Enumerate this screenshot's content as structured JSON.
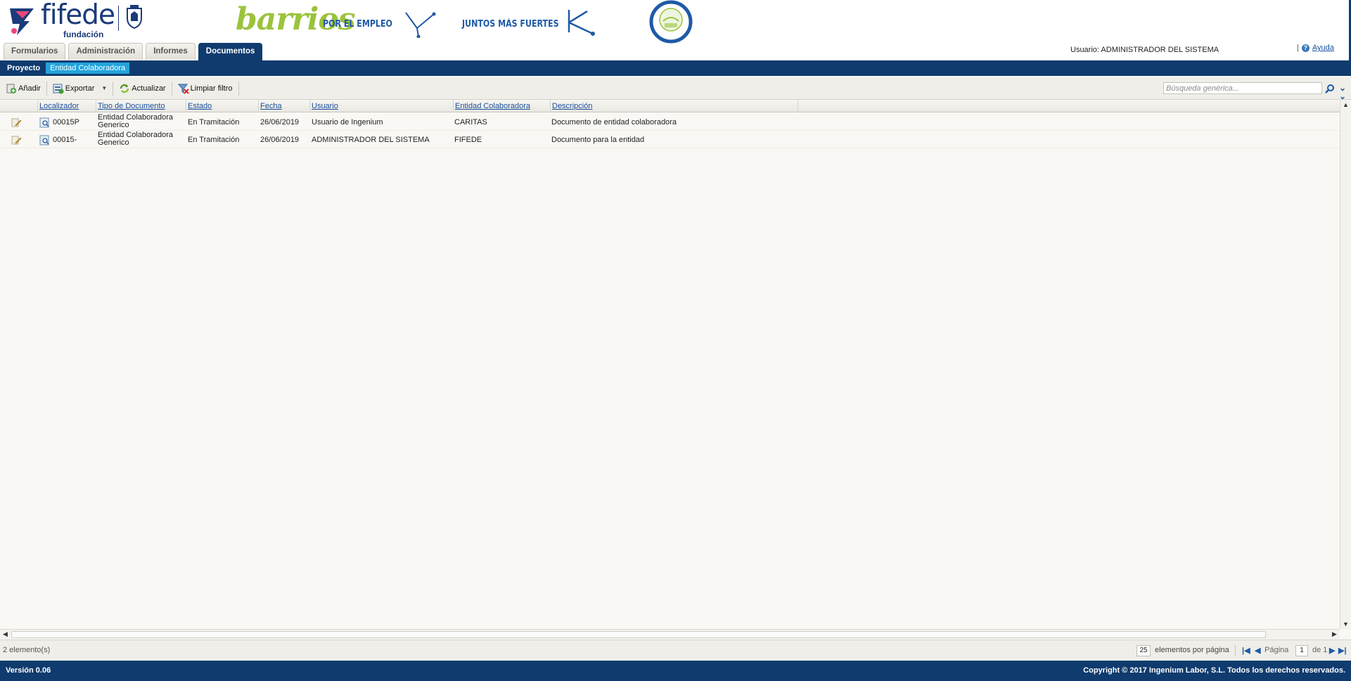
{
  "header": {
    "logo_word": "fifede",
    "logo_sub": "fundación",
    "banner_script": "barrios",
    "banner_text1": "POR EL EMPLEO",
    "banner_text2": "JUNTOS MÁS FUERTES",
    "user_label": "Usuario: ADMINISTRADOR DEL SISTEMA",
    "help_label": "Ayuda"
  },
  "tabs": [
    {
      "label": "Formularios",
      "active": false
    },
    {
      "label": "Administración",
      "active": false
    },
    {
      "label": "Informes",
      "active": false
    },
    {
      "label": "Documentos",
      "active": true
    }
  ],
  "subnav": [
    {
      "label": "Proyecto",
      "active": false
    },
    {
      "label": "Entidad Colaboradora",
      "active": true
    }
  ],
  "toolbar": {
    "add_label": "Añadir",
    "export_label": "Exportar",
    "refresh_label": "Actualizar",
    "clear_filter_label": "Limpiar filtro",
    "search_placeholder": "Búsqueda genérica..."
  },
  "grid": {
    "columns": [
      "Localizador",
      "Tipo de Documento",
      "Estado",
      "Fecha",
      "Usuario",
      "Entidad Colaboradora",
      "Descripción"
    ],
    "rows": [
      {
        "localizador": "00015P",
        "tipo_line1": "Entidad Colaboradora",
        "tipo_line2": "Generico",
        "estado": "En Tramitación",
        "fecha": "26/06/2019",
        "usuario": "Usuario de Ingenium",
        "entidad": "CARITAS",
        "descripcion": "Documento de entidad colaboradora"
      },
      {
        "localizador": "00015-",
        "tipo_line1": "Entidad Colaboradora",
        "tipo_line2": "Generico",
        "estado": "En Tramitación",
        "fecha": "26/06/2019",
        "usuario": "ADMINISTRADOR DEL SISTEMA",
        "entidad": "FIFEDE",
        "descripcion": "Documento para la entidad"
      }
    ]
  },
  "pager": {
    "count": "2 elemento(s)",
    "per_page_value": "25",
    "per_page_label": "elementos por página",
    "page_label": "Página",
    "page_value": "1",
    "of_label": "de 1"
  },
  "footer": {
    "version": "Versión 0.06",
    "copyright": "Copyright © 2017 Ingenium Labor, S.L. Todos los derechos reservados."
  },
  "colors": {
    "navy": "#0f3b6e",
    "accent_blue": "#23a4dc",
    "brand_green": "#9bc33c",
    "link_blue": "#1a4f9c"
  }
}
